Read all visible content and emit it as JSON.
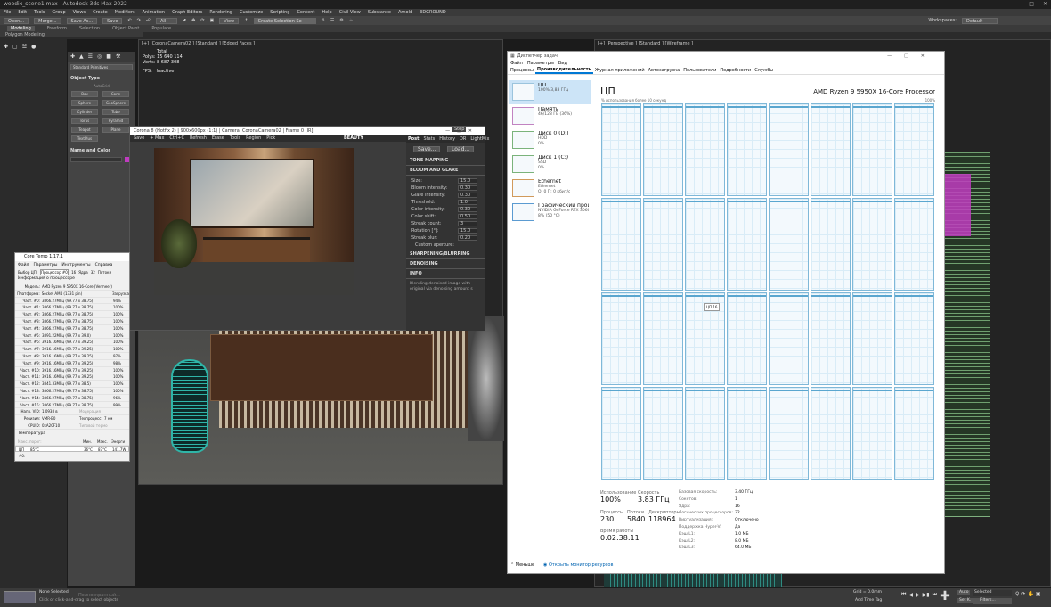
{
  "max": {
    "title": "woodix_scene1.max - Autodesk 3ds Max 2022",
    "menus": [
      "File",
      "Edit",
      "Tools",
      "Group",
      "Views",
      "Create",
      "Modifiers",
      "Animation",
      "Graph Editors",
      "Rendering",
      "Customize",
      "Scripting",
      "Content",
      "Help",
      "Civil View",
      "Substance",
      "Arnold",
      "3DGROUND"
    ],
    "toolbar": {
      "open": "Open...",
      "merge": "Merge...",
      "save_as": "Save As...",
      "save": "Save",
      "all": "All",
      "view": "View",
      "create_sel": "Create Selection Se",
      "workspaces": "Workspaces:",
      "workspace_val": "Default"
    },
    "ribbon_tabs": [
      "Modeling",
      "Freeform",
      "Selection",
      "Object Paint",
      "Populate"
    ],
    "ribbon_sub": "Polygon Modeling",
    "cmd": {
      "dropdown": "Standard Primitives",
      "object_type": "Object Type",
      "autogrid": "AutoGrid",
      "buttons": [
        "Box",
        "Cone",
        "Sphere",
        "GeoSphere",
        "Cylinder",
        "Tube",
        "Torus",
        "Pyramid",
        "Teapot",
        "Plane",
        "TextPlus"
      ],
      "name_color": "Name and Color"
    },
    "vp_left": {
      "label": "[+] [CoronaCamera02 ] [Standard ] [Edged Faces ]",
      "stats": {
        "total": "Total",
        "polys_label": "Polys:",
        "polys": "15 640 114",
        "verts_label": "Verts:",
        "verts": "8 687 308",
        "fps_label": "FPS:",
        "fps": "Inactive"
      }
    },
    "vp_right": {
      "label": "[+] [Perspective ] [Standard ] [Wireframe ]"
    },
    "status": {
      "none_selected": "None Selected",
      "hint": "Click or click-and-drag to select objects",
      "script_tab": "Полноэкранный...",
      "grid": "Grid = 0.0mm",
      "add_time_tag": "Add Time Tag",
      "selected": "Selected",
      "filters": "Filters...",
      "autokey": "Auto",
      "setk": "Set K."
    }
  },
  "corona": {
    "title": "Corona 8 (Hotfix 2) | 900x600px (1:1) | Camera: CoronaCamera02 | Frame 0 [IR]",
    "toolbar": [
      "Save",
      "+ Max",
      "Ctrl+C",
      "Refresh",
      "Erase",
      "Tools",
      "Region",
      "Pick"
    ],
    "beauty": "BEAUTY",
    "tabs": [
      "Post",
      "Stats",
      "History",
      "DR",
      "LightMix"
    ],
    "stop": "Stop",
    "save": "Save...",
    "load": "Load...",
    "tone_mapping": "TONE MAPPING",
    "bloom": "BLOOM AND GLARE",
    "params": [
      [
        "Size:",
        "15.0"
      ],
      [
        "Bloom intensity:",
        "0.30"
      ],
      [
        "Glare intensity:",
        "0.30"
      ],
      [
        "Threshold:",
        "1.0"
      ],
      [
        "Color intensity:",
        "0.30"
      ],
      [
        "Color shift:",
        "0.50"
      ],
      [
        "Streak count:",
        "3"
      ],
      [
        "Rotation [°]:",
        "15.0"
      ],
      [
        "Streak blur:",
        "0.20"
      ]
    ],
    "custom_aperture": "Custom aperture:",
    "sharpening": "SHARPENING/BLURRING",
    "denoising": "DENOISING",
    "info": "INFO",
    "info_text": "Blending denoised image with original via denoising amount s"
  },
  "coretemp": {
    "title": "Core Temp 1.17.1",
    "menus": [
      "Файл",
      "Параметры",
      "Инструменты",
      "Справка"
    ],
    "select_cpu": "Выбор ЦП:",
    "proc": "Процессор #0",
    "cores_val": "16",
    "cores": "Ядра",
    "threads_val": "32",
    "threads": "Потоки",
    "info": "Информация о процессоре",
    "model_label": "Модель:",
    "model": "AMD Ryzen 9 5950X 16-Core (Vermeer)",
    "platform_label": "Платформа:",
    "platform": "Socket AM4 (1331 pin)",
    "load_label": "Загрузка",
    "freqs": [
      [
        "Част. #0:",
        "3866.27МГц (99.77 x 38.75)",
        "94%"
      ],
      [
        "Част. #1:",
        "3866.27МГц (99.77 x 38.75)",
        "100%"
      ],
      [
        "Част. #2:",
        "3866.27МГц (99.77 x 38.75)",
        "100%"
      ],
      [
        "Част. #3:",
        "3866.27МГц (99.77 x 38.75)",
        "100%"
      ],
      [
        "Част. #4:",
        "3866.27МГц (99.77 x 38.75)",
        "100%"
      ],
      [
        "Част. #5:",
        "3891.22МГц (99.77 x 39.0)",
        "100%"
      ],
      [
        "Част. #6:",
        "3916.16МГц (99.77 x 39.25)",
        "100%"
      ],
      [
        "Част. #7:",
        "3916.16МГц (99.77 x 39.25)",
        "100%"
      ],
      [
        "Част. #8:",
        "3916.16МГц (99.77 x 39.25)",
        "97%"
      ],
      [
        "Част. #9:",
        "3916.16МГц (99.77 x 39.25)",
        "98%"
      ],
      [
        "Част. #10:",
        "3916.16МГц (99.77 x 39.25)",
        "100%"
      ],
      [
        "Част. #11:",
        "3916.16МГц (99.77 x 39.25)",
        "100%"
      ],
      [
        "Част. #12:",
        "3841.33МГц (99.77 x 38.5)",
        "100%"
      ],
      [
        "Част. #13:",
        "3866.27МГц (99.77 x 38.75)",
        "100%"
      ],
      [
        "Част. #14:",
        "3866.27МГц (99.77 x 38.75)",
        "96%"
      ],
      [
        "Част. #15:",
        "3866.27МГц (99.77 x 38.75)",
        "99%"
      ]
    ],
    "vid_label": "Напр. VID:",
    "vid": "1.0938 в",
    "mod_label": "Модерация",
    "rev_label": "Ревизия:",
    "rev": "VMR-B0",
    "tech_label": "Техпроцесс:",
    "tech": "7 нм",
    "cpuid_label": "CPUID:",
    "cpuid": "0xA20F10",
    "tdp_label": "Типовой термо",
    "temp_header": "Температура",
    "temp_cols": [
      "Мин.",
      "Макс.",
      "Энерги"
    ],
    "tj_label": "Макс. порог:",
    "cpu_row": [
      "ЦП #0:",
      "85°C",
      "36°C",
      "87°C",
      "141.7W"
    ]
  },
  "taskman": {
    "title": "Диспетчер задач",
    "menus": [
      "Файл",
      "Параметры",
      "Вид"
    ],
    "tabs": [
      "Процессы",
      "Производительность",
      "Журнал приложений",
      "Автозагрузка",
      "Пользователи",
      "Подробности",
      "Службы"
    ],
    "items": [
      {
        "name": "ЦП",
        "sub": "100% 3,83 ГГц",
        "sub2": ""
      },
      {
        "name": "Память",
        "sub": "46/128 ГБ (36%)",
        "sub2": ""
      },
      {
        "name": "Диск 0 (D:)",
        "sub": "HDD",
        "sub2": "0%"
      },
      {
        "name": "Диск 1 (C:)",
        "sub": "SSD",
        "sub2": "0%"
      },
      {
        "name": "Ethernet",
        "sub": "Ethernet",
        "sub2": "О: 0 П: 0 кбит/с"
      },
      {
        "name": "Графический процессор 0",
        "sub": "NVIDIA GeForce RTX 3060 Ti",
        "sub2": "8% (50 °C)"
      }
    ],
    "heading": "ЦП",
    "cpu_model": "AMD Ryzen 9 5950X 16-Core Processor",
    "graph_label": "% использования более 10 секунд",
    "graph_max": "100%",
    "tooltip": "ЦП 16",
    "usage_label": "Использование",
    "usage": "100%",
    "speed_label": "Скорость",
    "speed": "3.83 ГГц",
    "proc_label": "Процессы",
    "proc": "230",
    "threads_label": "Потоки",
    "threads": "5840",
    "handles_label": "Дескрипторы",
    "handles": "118964",
    "uptime_label": "Время работы",
    "uptime": "0:02:38:11",
    "specs": [
      [
        "Базовая скорость:",
        "3.40 ГГц"
      ],
      [
        "Сокетов:",
        "1"
      ],
      [
        "Ядра:",
        "16"
      ],
      [
        "Логических процессоров:",
        "32"
      ],
      [
        "Виртуализация:",
        "Отключено"
      ],
      [
        "Поддержка Hyper-V:",
        "Да"
      ],
      [
        "Кэш L1:",
        "1.0 МБ"
      ],
      [
        "Кэш L2:",
        "8.0 МБ"
      ],
      [
        "Кэш L3:",
        "64.0 МБ"
      ]
    ],
    "less": "Меньше",
    "monitor": "Открыть монитор ресурсов"
  }
}
